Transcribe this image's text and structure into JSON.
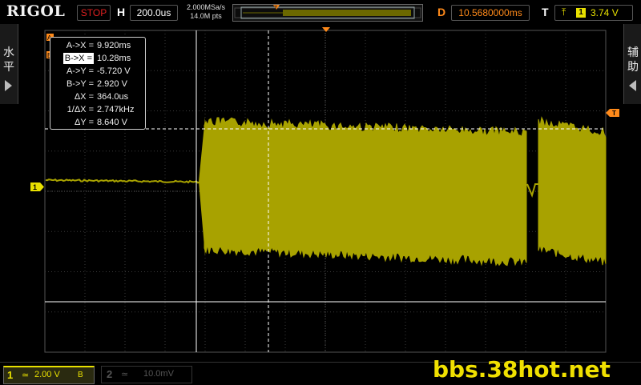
{
  "header": {
    "brand": "RIGOL",
    "run_state": "STOP",
    "timebase_label": "H",
    "timebase_value": "200.0us",
    "sample_rate": "2.000MSa/s",
    "memory_depth": "14.0M pts",
    "trigger_marker": "T",
    "delay_label": "D",
    "delay_value": "10.5680000ms",
    "trigger_label": "T",
    "trigger_source": "1",
    "trigger_level": "3.74 V"
  },
  "side_tabs": {
    "left": [
      "水",
      "平"
    ],
    "right": [
      "辅",
      "助"
    ]
  },
  "markers": {
    "channel1": "1",
    "trigger_level": "T",
    "cursor_a": "A",
    "cursor_b": "B"
  },
  "cursor_measurements": [
    {
      "label": "A->X =",
      "value": "9.920ms",
      "selected": false
    },
    {
      "label": "B->X =",
      "value": "10.28ms",
      "selected": true
    },
    {
      "label": "A->Y =",
      "value": "-5.720 V",
      "selected": false
    },
    {
      "label": "B->Y =",
      "value": "2.920 V",
      "selected": false
    },
    {
      "label": "ΔX =",
      "value": "364.0us",
      "selected": false
    },
    {
      "label": "1/ΔX =",
      "value": "2.747kHz",
      "selected": false
    },
    {
      "label": "ΔY =",
      "value": "8.640 V",
      "selected": false
    }
  ],
  "channels": [
    {
      "number": "1",
      "coupling": "≃",
      "scale": "2.00 V",
      "bw": "B",
      "active": true
    },
    {
      "number": "2",
      "coupling": "≃",
      "scale": "10.0mV",
      "active": false
    }
  ],
  "watermark": "bbs.38hot.net",
  "colors": {
    "ch1_trace": "#a8a200",
    "ch1_label": "#e8e000",
    "delay_orange": "#ff8a1a",
    "stop_red": "#e02020",
    "grid": "#3a3a3a",
    "cursor": "#ffffff"
  }
}
